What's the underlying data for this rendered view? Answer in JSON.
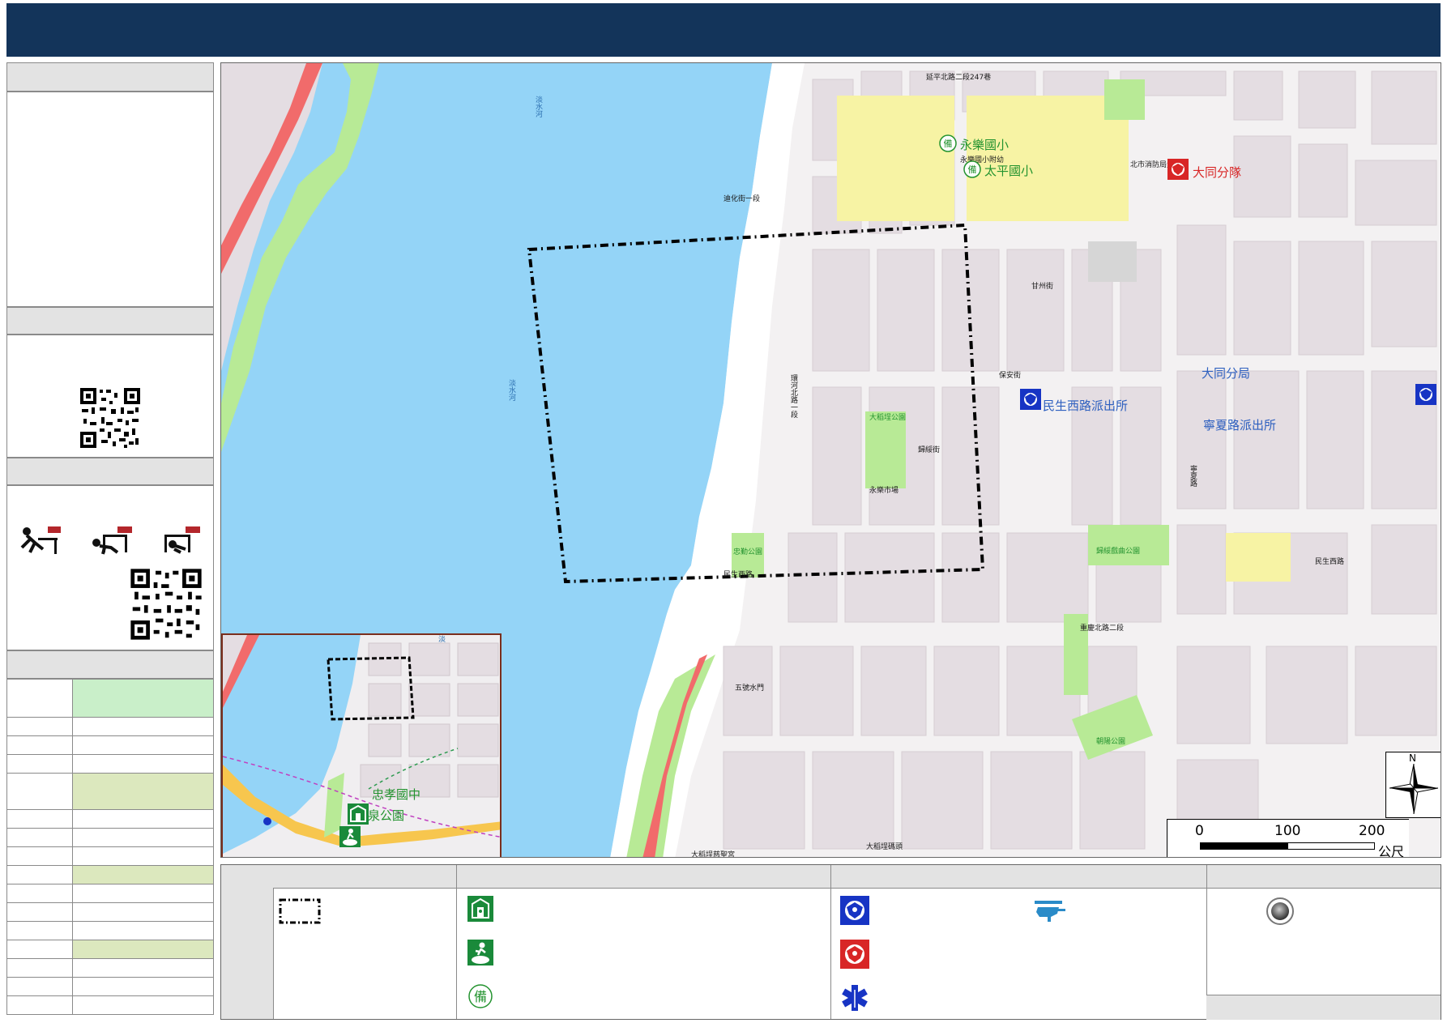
{
  "map_labels": {
    "river_main": "淡水河",
    "river_top": "淡水河",
    "school_1": "永樂國小",
    "school_2": "太平國小",
    "police_squad": "大同分隊",
    "police_bureau": "大同分局",
    "police_station_1": "民生西路派出所",
    "police_station_2": "寧夏路派出所",
    "inset_school": "忠孝國中",
    "inset_park": "玉泉公園",
    "street_yanping": "延平北路二段247巷",
    "street_guide": "環河北路一段",
    "street_minsheng": "民生西路",
    "street_guisui": "歸綏街",
    "street_ganzhou": "甘州街",
    "street_baoan": "保安街",
    "street_dihua": "迪化街一段",
    "street_chongqing": "重慶北路二段",
    "street_ningxia": "寧夏路",
    "park_1": "大稻埕公園",
    "park_2": "忠勤公園",
    "park_3": "朝陽公園",
    "park_4": "歸綏戲曲公園",
    "kindergarten": "永樂國小附幼",
    "market": "永樂市場",
    "fire_station": "北市消防局大同",
    "pier": "大稻埕碼頭",
    "temple": "大稻埕慈聖宮",
    "legend_gate": "五號水門"
  },
  "scale_bar": {
    "ticks": [
      "0",
      "100",
      "200"
    ],
    "unit": "公尺"
  },
  "north_arrow": {
    "label": "N"
  },
  "inset_map": {
    "label_top": "淡"
  },
  "icons": {
    "police_blue": "police-badge-blue-icon",
    "police_red": "police-badge-red-icon",
    "shelter": "evacuation-shelter-icon",
    "runner": "refuge-area-icon",
    "reserve": "reserve-shelter-icon",
    "helicopter": "helicopter-landing-icon",
    "medical": "medical-star-icon",
    "point": "disaster-point-icon"
  },
  "colors": {
    "header_navy": "#13345a",
    "river_blue": "#94d4f7",
    "road_red": "#f16b6b",
    "park_green": "#b8ea96",
    "school_yellow": "#f7f3a4",
    "block_gray": "#e4dde2",
    "police_blue": "#1734c4",
    "police_red": "#d82626"
  }
}
